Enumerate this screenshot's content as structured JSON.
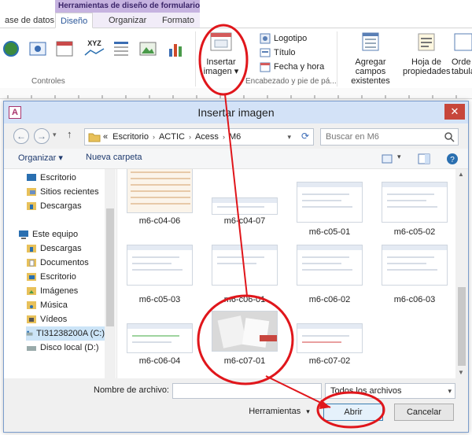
{
  "ribbon": {
    "context_header": "Herramientas de diseño de formulario",
    "tabs": [
      {
        "label": "ase de datos"
      },
      {
        "label": "Diseño"
      },
      {
        "label": "Organizar"
      },
      {
        "label": "Formato"
      }
    ],
    "groups": {
      "controles": "Controles",
      "encabezado": "Encabezado y pie de pá..."
    },
    "insert_image": {
      "line1": "Insertar",
      "line2": "imagen ▾"
    },
    "small_buttons": {
      "logotipo": "Logotipo",
      "titulo": "Título",
      "fecha_hora": "Fecha y hora"
    },
    "xyz_label": "XYZ",
    "agregar_campos": {
      "line1": "Agregar campos",
      "line2": "existentes"
    },
    "hoja_propiedades": {
      "line1": "Hoja de",
      "line2": "propiedades"
    },
    "orden": {
      "line1": "Orde",
      "line2": "tabula"
    }
  },
  "dialog": {
    "app_badge": "A",
    "title": "Insertar imagen",
    "close_glyph": "✕",
    "address": {
      "prefix": "«",
      "segments": [
        "Escritorio",
        "ACTIC",
        "Acess",
        "M6"
      ]
    },
    "search_placeholder": "Buscar en M6",
    "toolbar": {
      "organize": "Organizar ▾",
      "new_folder": "Nueva carpeta"
    },
    "tree": {
      "favorites": [
        "Escritorio",
        "Sitios recientes",
        "Descargas"
      ],
      "this_pc": "Este equipo",
      "pc_items": [
        "Descargas",
        "Documentos",
        "Escritorio",
        "Imágenes",
        "Música",
        "Vídeos",
        "TI31238200A (C:)",
        "Disco local (D:)"
      ]
    },
    "files": [
      "m6-c04-06",
      "m6-c04-07",
      "m6-c05-01",
      "m6-c05-02",
      "m6-c05-03",
      "m6-c06-01",
      "m6-c06-02",
      "m6-c06-03",
      "m6-c06-04",
      "m6-c07-01",
      "m6-c07-02"
    ],
    "bottom": {
      "filename_label": "Nombre de archivo:",
      "filename_value": "",
      "filter": "Todos los archivos",
      "tools": "Herramientas",
      "open": "Abrir",
      "cancel": "Cancelar"
    }
  },
  "colors": {
    "annotation": "#e0161b",
    "context_tab": "#c6b3e0",
    "title_bar": "#d3e2f7",
    "close_button": "#c7463b"
  }
}
